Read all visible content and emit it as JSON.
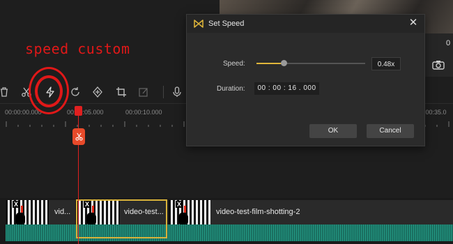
{
  "dialog": {
    "title": "Set Speed",
    "close_glyph": "✕",
    "speed_label": "Speed:",
    "speed_value": "0.48x",
    "speed_slider_fraction": 0.25,
    "duration_label": "Duration:",
    "duration_value": "00 : 00 : 16 . 000",
    "ok_label": "OK",
    "cancel_label": "Cancel"
  },
  "annotation": {
    "text": "speed custom"
  },
  "side_panel": {
    "value": "0"
  },
  "ruler": {
    "labels": [
      "00:00:00.000",
      "00:00:05.000",
      "00:00:10.000",
      "00:00:35.0"
    ]
  },
  "track": {
    "clips": [
      {
        "label": "vid..."
      },
      {
        "label": "video-test..."
      },
      {
        "label": "video-test-film-shotting-2"
      }
    ]
  },
  "toolbar": {
    "icons": [
      "trash-icon",
      "scissors-icon",
      "speed-icon",
      "rotate-icon",
      "add-marker-icon",
      "crop-icon",
      "edit-icon",
      "mic-icon"
    ]
  },
  "colors": {
    "accent": "#e0b63a",
    "annotation_red": "#e01818",
    "playhead": "#e02020",
    "audio": "#1e7a6a"
  }
}
